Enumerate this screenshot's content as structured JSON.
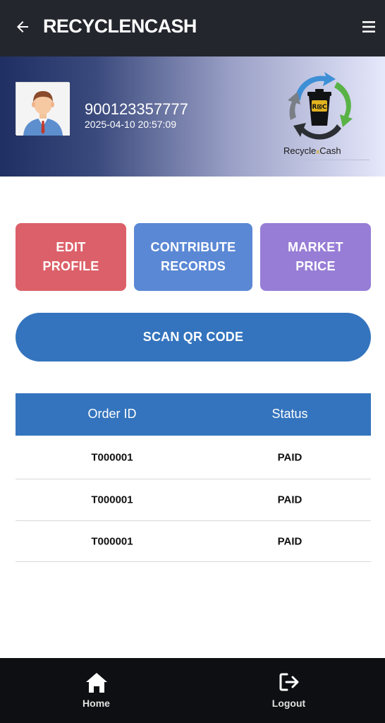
{
  "app": {
    "title": "RECYCLENCASH"
  },
  "profile": {
    "user_id": "900123357777",
    "timestamp": "2025-04-10 20:57:09",
    "logo": {
      "badge": "R⊠C",
      "brand_left": "Recycle",
      "brand_x": "x",
      "brand_right": "Cash"
    }
  },
  "actions": {
    "edit_profile": "EDIT\nPROFILE",
    "contribute_records": "CONTRIBUTE\nRECORDS",
    "market_price": "MARKET\nPRICE",
    "scan_qr": "SCAN QR CODE"
  },
  "table": {
    "headers": [
      "Order ID",
      "Status"
    ],
    "rows": [
      {
        "order_id": "T000001",
        "status": "PAID"
      },
      {
        "order_id": "T000001",
        "status": "PAID"
      },
      {
        "order_id": "T000001",
        "status": "PAID"
      }
    ]
  },
  "bottom_nav": {
    "home_label": "Home",
    "logout_label": "Logout"
  },
  "colors": {
    "topbar": "#23262d",
    "edit": "#dc6069",
    "contribute": "#5b88d5",
    "market": "#977dd6",
    "primary": "#3474be"
  }
}
